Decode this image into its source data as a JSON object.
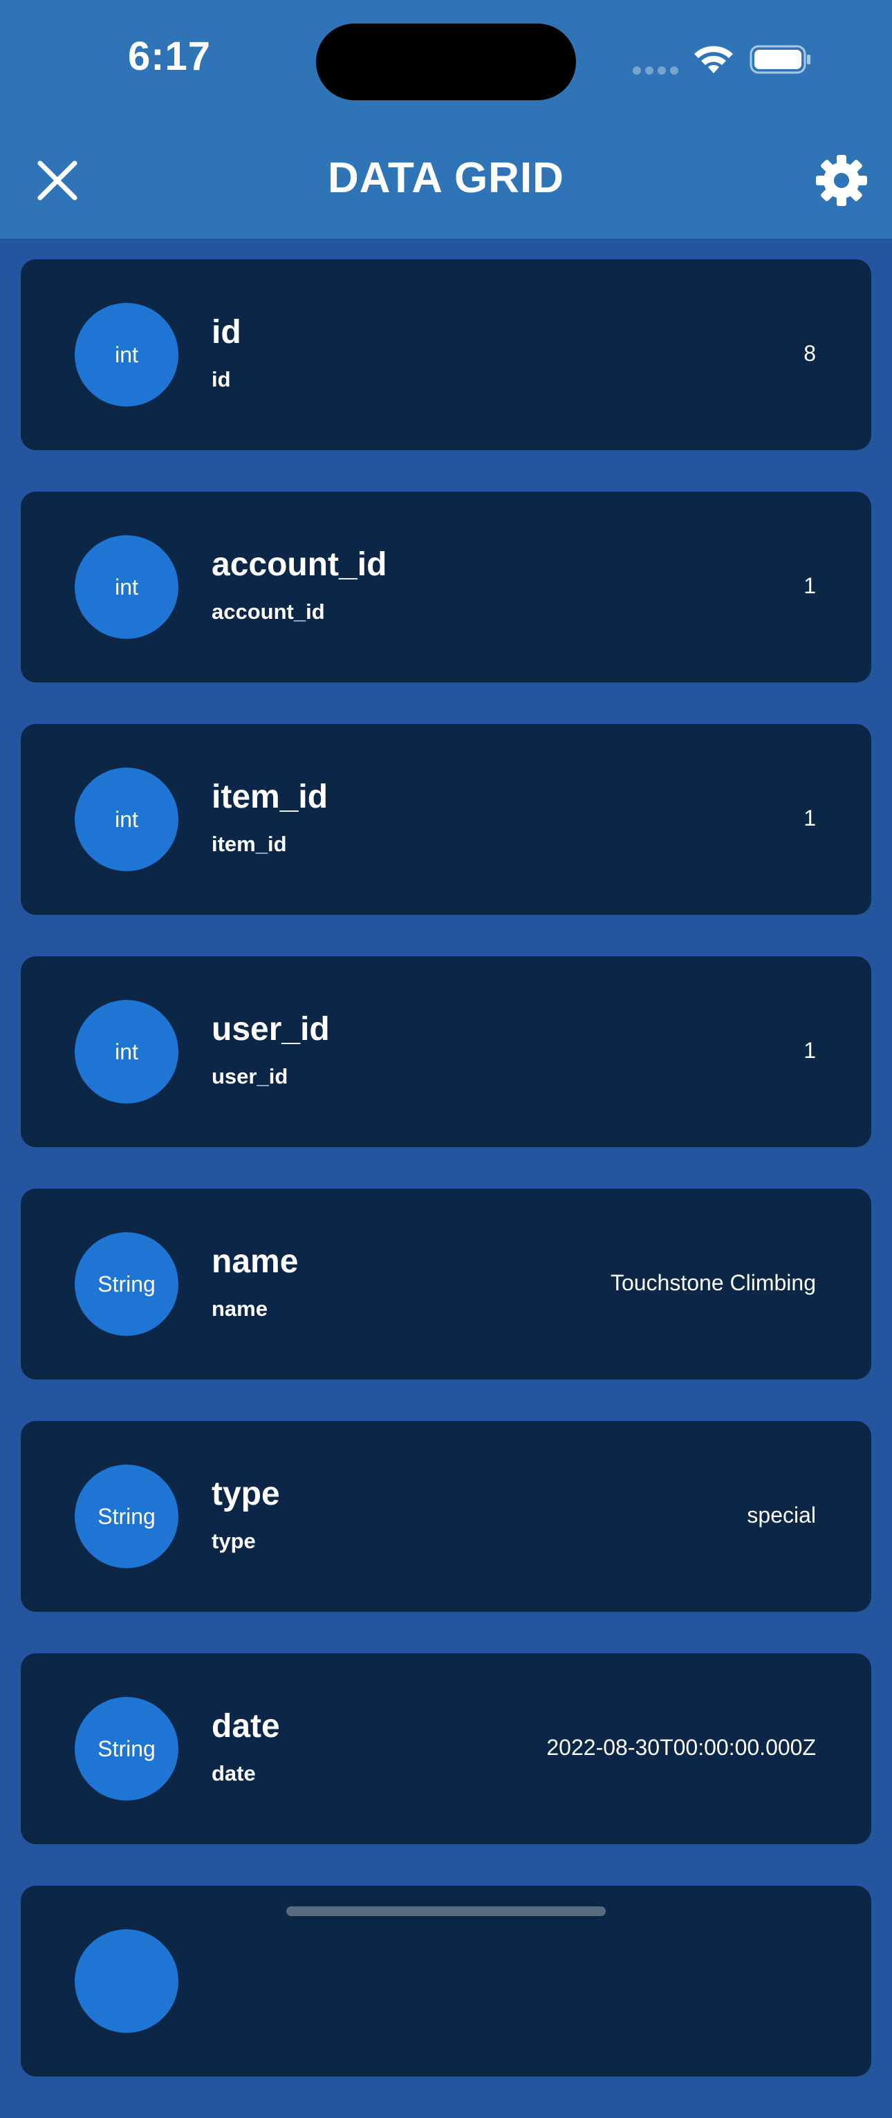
{
  "status_bar": {
    "time": "6:17"
  },
  "nav": {
    "title": "DATA GRID",
    "close_icon": "close-icon",
    "settings_icon": "gear-icon"
  },
  "colors": {
    "header_bg": "#2f74b6",
    "page_bg": "#2456a0",
    "card_bg": "#0b2647",
    "badge_bg": "#1e75d3"
  },
  "fields": [
    {
      "type": "int",
      "title": "id",
      "subtitle": "id",
      "value": "8"
    },
    {
      "type": "int",
      "title": "account_id",
      "subtitle": "account_id",
      "value": "1"
    },
    {
      "type": "int",
      "title": "item_id",
      "subtitle": "item_id",
      "value": "1"
    },
    {
      "type": "int",
      "title": "user_id",
      "subtitle": "user_id",
      "value": "1"
    },
    {
      "type": "String",
      "title": "name",
      "subtitle": "name",
      "value": "Touchstone Climbing"
    },
    {
      "type": "String",
      "title": "type",
      "subtitle": "type",
      "value": "special"
    },
    {
      "type": "String",
      "title": "date",
      "subtitle": "date",
      "value": "2022-08-30T00:00:00.000Z"
    }
  ]
}
